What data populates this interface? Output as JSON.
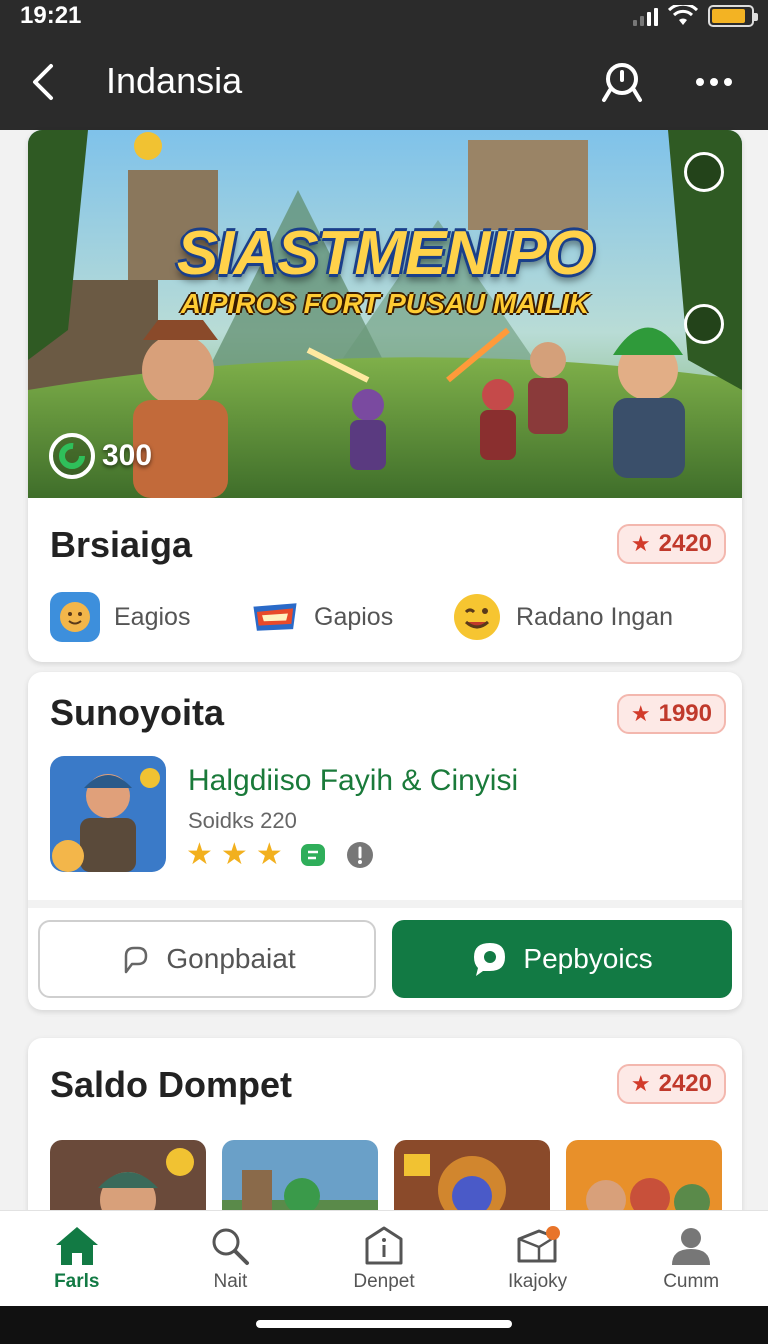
{
  "status_bar": {
    "time": "19:21"
  },
  "app_bar": {
    "title": "Indansia"
  },
  "hero": {
    "title": "SIASTMENIPO",
    "subtitle": "AIPIROS FORT PUSAU MAILIK",
    "badge_value": "300"
  },
  "section1": {
    "title": "Brsiaiga",
    "points": "2420",
    "chips": [
      {
        "label": "Eagios",
        "icon": "face-app-icon"
      },
      {
        "label": "Gapios",
        "icon": "game-logo-icon"
      },
      {
        "label": "Radano Ingan",
        "icon": "emoji-wink-icon"
      }
    ]
  },
  "section2": {
    "title": "Sunoyoita",
    "points": "1990",
    "game": {
      "name": "Halgdiiso Fayih & Cinyisi",
      "meta": "Soidks 220",
      "stars": 3
    },
    "secondary_button": "Gonpbaiat",
    "primary_button": "Pepbyoics"
  },
  "section3": {
    "title": "Saldo Dompet",
    "points": "2420"
  },
  "bottom_nav": [
    {
      "label": "Farls",
      "icon": "home-icon",
      "active": true
    },
    {
      "label": "Nait",
      "icon": "search-icon",
      "active": false
    },
    {
      "label": "Denpet",
      "icon": "wallet-icon",
      "active": false
    },
    {
      "label": "Ikajoky",
      "icon": "inbox-icon",
      "active": false
    },
    {
      "label": "Cumm",
      "icon": "profile-icon",
      "active": false
    }
  ],
  "colors": {
    "app_bar": "#2b2b2b",
    "accent_green": "#127a44",
    "points_red": "#c0392b",
    "star_gold": "#f2b01e"
  }
}
